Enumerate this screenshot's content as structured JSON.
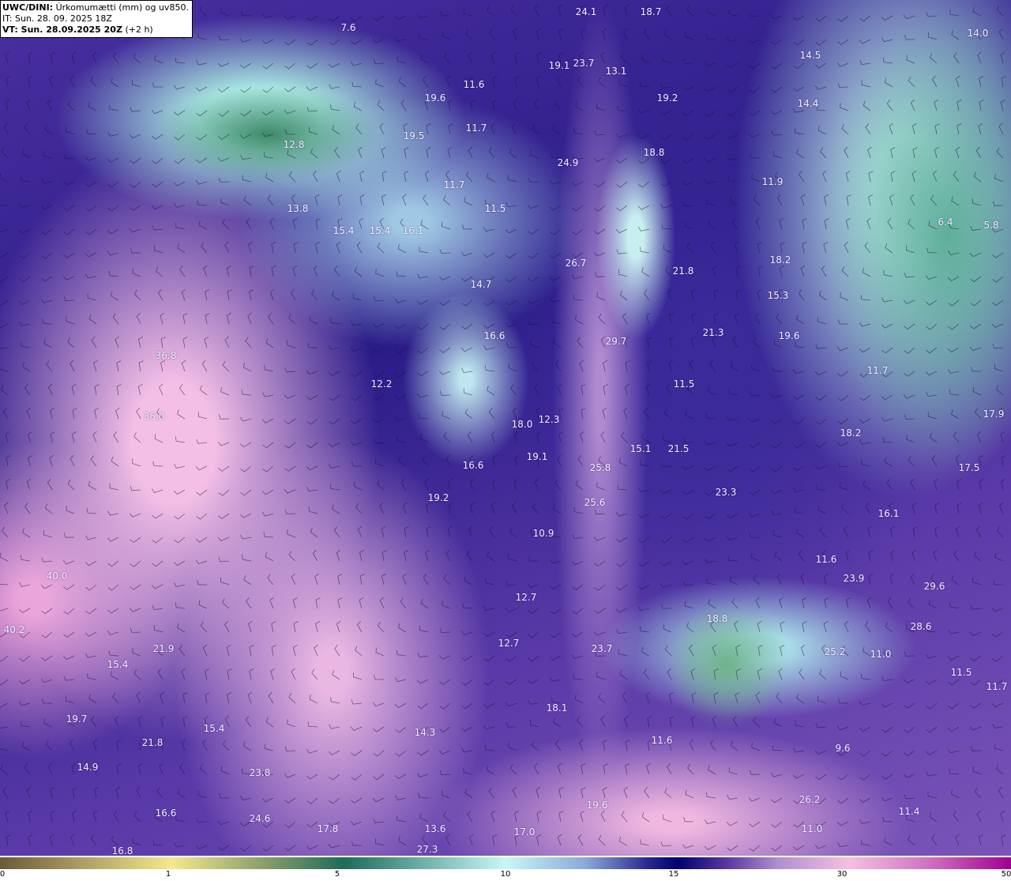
{
  "header": {
    "model": "UWC/DINI:",
    "description": "Úrkomumætti (mm) og uv850.",
    "init_time": "IT: Sun. 28. 09. 2025 18Z",
    "valid_time": "VT: Sun. 28.09.2025 20Z",
    "lead": "(+2 h)"
  },
  "colorbar": {
    "ticks": [
      "0",
      "1",
      "5",
      "10",
      "15",
      "30",
      "50"
    ],
    "colors": [
      "#6b5a3a",
      "#f5e88c",
      "#1f6b5a",
      "#c8f7f7",
      "#000070",
      "#f5c0e0",
      "#a00090"
    ]
  },
  "map_labels": [
    "24.1",
    "18.7",
    "14.0",
    "7.6",
    "14.5",
    "19.1",
    "23.7",
    "13.1",
    "11.6",
    "19.6",
    "19.2",
    "14.4",
    "11.7",
    "19.5",
    "12.8",
    "18.8",
    "24.9",
    "11.7",
    "11.9",
    "13.8",
    "11.5",
    "15.4",
    "15.4",
    "16.1",
    "6.4",
    "5.8",
    "26.7",
    "18.2",
    "21.8",
    "14.7",
    "15.3",
    "21.3",
    "16.6",
    "29.7",
    "19.6",
    "36.8",
    "12.2",
    "11.5",
    "11.7",
    "36.0",
    "18.0",
    "12.3",
    "17.9",
    "18.2",
    "15.1",
    "21.5",
    "19.1",
    "16.6",
    "25.8",
    "17.5",
    "19.2",
    "23.3",
    "25.6",
    "16.1",
    "10.9",
    "11.6",
    "40.0",
    "23.9",
    "29.6",
    "12.7",
    "18.8",
    "40.2",
    "28.6",
    "12.7",
    "23.7",
    "25.2",
    "11.0",
    "21.9",
    "15.4",
    "11.5",
    "11.7",
    "18.1",
    "19.7",
    "15.4",
    "14.3",
    "11.6",
    "21.8",
    "9.6",
    "14.9",
    "23.8",
    "16.6",
    "24.6",
    "19.6",
    "11.4",
    "26.2",
    "17.8",
    "13.6",
    "17.0",
    "11.0",
    "16.8",
    "27.3"
  ]
}
